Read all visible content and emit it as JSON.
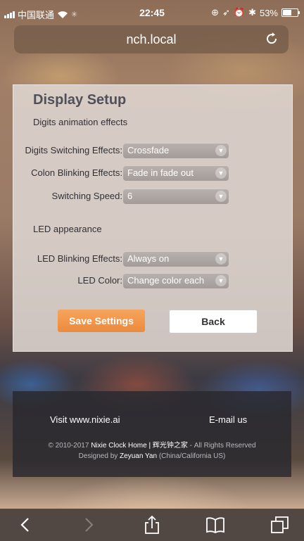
{
  "status_bar": {
    "carrier": "中国联通",
    "time": "22:45",
    "battery": "53%"
  },
  "url_bar": {
    "url": "nch.local"
  },
  "panel": {
    "title": "Display Setup",
    "section_digits": "Digits animation effects",
    "rows": [
      {
        "label": "Digits Switching Effects:",
        "value": "Crossfade"
      },
      {
        "label": "Colon Blinking Effects:",
        "value": "Fade in fade out"
      },
      {
        "label": "Switching Speed:",
        "value": "6"
      }
    ],
    "section_led": "LED appearance",
    "led_rows": [
      {
        "label": "LED Blinking Effects:",
        "value": "Always on"
      },
      {
        "label": "LED Color:",
        "value": "Change color each"
      }
    ],
    "save_label": "Save Settings",
    "back_label": "Back"
  },
  "footer": {
    "visit": "Visit www.nixie.ai",
    "email": "E-mail us",
    "copyright_prefix": "© 2010-2017",
    "site_name": "Nixie Clock Home | 辉光钟之家",
    "rights": "- All Rights Reserved",
    "designed_by": "Designed by",
    "designer": "Zeyuan Yan",
    "location": "(China/California US)"
  }
}
